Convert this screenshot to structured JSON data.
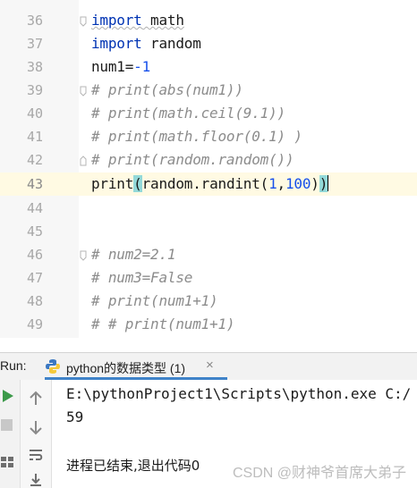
{
  "editor": {
    "lines": [
      {
        "num": "36",
        "kind": "import_math"
      },
      {
        "num": "37",
        "kind": "import_random"
      },
      {
        "num": "38",
        "kind": "assign_num1"
      },
      {
        "num": "39",
        "kind": "comment",
        "text": "# print(abs(num1))"
      },
      {
        "num": "40",
        "kind": "comment",
        "text": "# print(math.ceil(9.1))"
      },
      {
        "num": "41",
        "kind": "comment",
        "text": "# print(math.floor(0.1) )"
      },
      {
        "num": "42",
        "kind": "comment",
        "text": "# print(random.random())"
      },
      {
        "num": "43",
        "kind": "current"
      },
      {
        "num": "44",
        "kind": "blank"
      },
      {
        "num": "45",
        "kind": "blank"
      },
      {
        "num": "46",
        "kind": "comment",
        "text": "# num2=2.1"
      },
      {
        "num": "47",
        "kind": "comment",
        "text": "# num3=False"
      },
      {
        "num": "48",
        "kind": "comment",
        "text": "# print(num1+1)"
      },
      {
        "num": "49",
        "kind": "comment",
        "text": "# # print(num1+1)"
      }
    ],
    "tokens": {
      "import": "import",
      "math": " math",
      "random": " random",
      "num1": "num1=",
      "neg1": "-1",
      "print": "print",
      "open": "(",
      "call": "random.randint(",
      "one": "1",
      "comma": ",",
      "hundred": "100",
      "close1": ")",
      "close2": ")"
    }
  },
  "run": {
    "label": "Run:",
    "tab_label": "python的数据类型 (1)",
    "close": "×"
  },
  "console": {
    "command": "E:\\pythonProject1\\Scripts\\python.exe C:/",
    "output": "59",
    "exit": "进程已结束,退出代码0",
    "watermark": "CSDN @财神爷首席大弟子"
  },
  "colors": {
    "keyword": "#0033b3",
    "number": "#1750eb",
    "comment": "#8c8c8c",
    "current_line": "#fffae3",
    "bracket_highlight": "#93d9d9",
    "run_green": "#3c9a4a",
    "tab_underline": "#4083c9"
  },
  "icons": [
    "fold-marker-icon",
    "python-file-icon",
    "close-icon",
    "rerun-icon",
    "stop-icon",
    "layout-icon",
    "up-arrow-icon",
    "down-arrow-icon",
    "soft-wrap-icon",
    "scroll-to-end-icon"
  ]
}
